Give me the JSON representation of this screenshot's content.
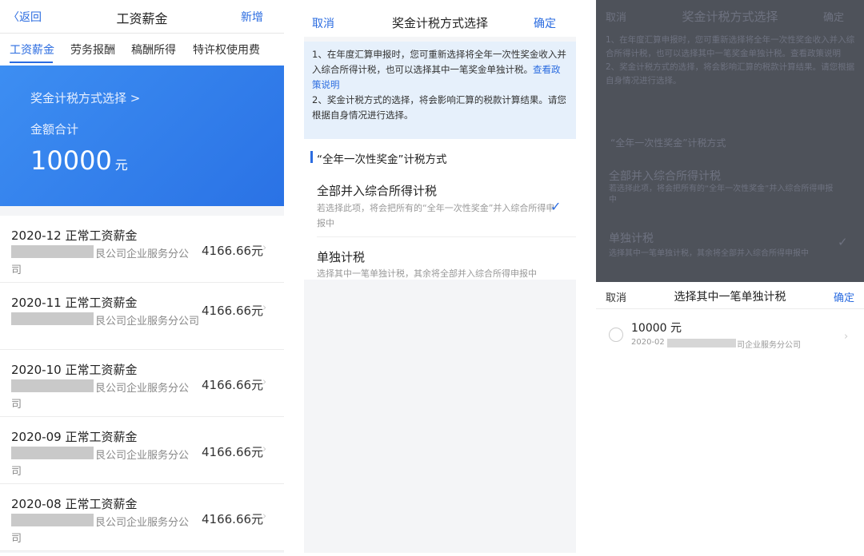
{
  "salary_screen": {
    "nav": {
      "back": "〈返回",
      "title": "工资薪金",
      "add": "新增"
    },
    "tabs": [
      "工资薪金",
      "劳务报酬",
      "稿酬所得",
      "特许权使用费"
    ],
    "banner": {
      "method_link": "奖金计税方式选择 >",
      "sum_label": "金额合计",
      "amount": "10000",
      "unit": "元"
    },
    "rows": [
      {
        "title": "2020-12 正常工资薪金",
        "company": "艮公司企业服务分公",
        "company_tail": "司",
        "amount": "4166.66元"
      },
      {
        "title": "2020-11 正常工资薪金",
        "company": "艮公司企业服务分公司",
        "company_tail": "",
        "amount": "4166.66元"
      },
      {
        "title": "2020-10 正常工资薪金",
        "company": "艮公司企业服务分公",
        "company_tail": "司",
        "amount": "4166.66元"
      },
      {
        "title": "2020-09 正常工资薪金",
        "company": "艮公司企业服务分公",
        "company_tail": "司",
        "amount": "4166.66元"
      },
      {
        "title": "2020-08 正常工资薪金",
        "company": "艮公司企业服务分公",
        "company_tail": "司",
        "amount": "4166.66元"
      }
    ],
    "chevron": "›"
  },
  "method_screen": {
    "nav": {
      "cancel": "取消",
      "title": "奖金计税方式选择",
      "confirm": "确定"
    },
    "notice": {
      "p1": "1、在年度汇算申报时，您可重新选择将全年一次性奖金收入并入综合所得计税，也可以选择其中一笔奖金单独计税。",
      "link": "查看政策说明",
      "p2": "2、奖金计税方式的选择，将会影响汇算的税款计算结果。请您根据自身情况进行选择。"
    },
    "section_title": "“全年一次性奖金”计税方式",
    "option1": {
      "title": "全部并入综合所得计税",
      "desc": "若选择此项，将会把所有的“全年一次性奖金”并入综合所得申报中",
      "selected": true,
      "check": "✓"
    },
    "option2": {
      "title": "单独计税",
      "desc": "选择其中一笔单独计税，其余将全部并入综合所得申报中"
    }
  },
  "picker_screen": {
    "sheet": {
      "cancel": "取消",
      "title": "选择其中一笔单独计税",
      "confirm": "确定"
    },
    "item": {
      "amount": "10000 元",
      "date": "2020-02",
      "company": "司企业服务分公司"
    },
    "chevron": "›"
  }
}
